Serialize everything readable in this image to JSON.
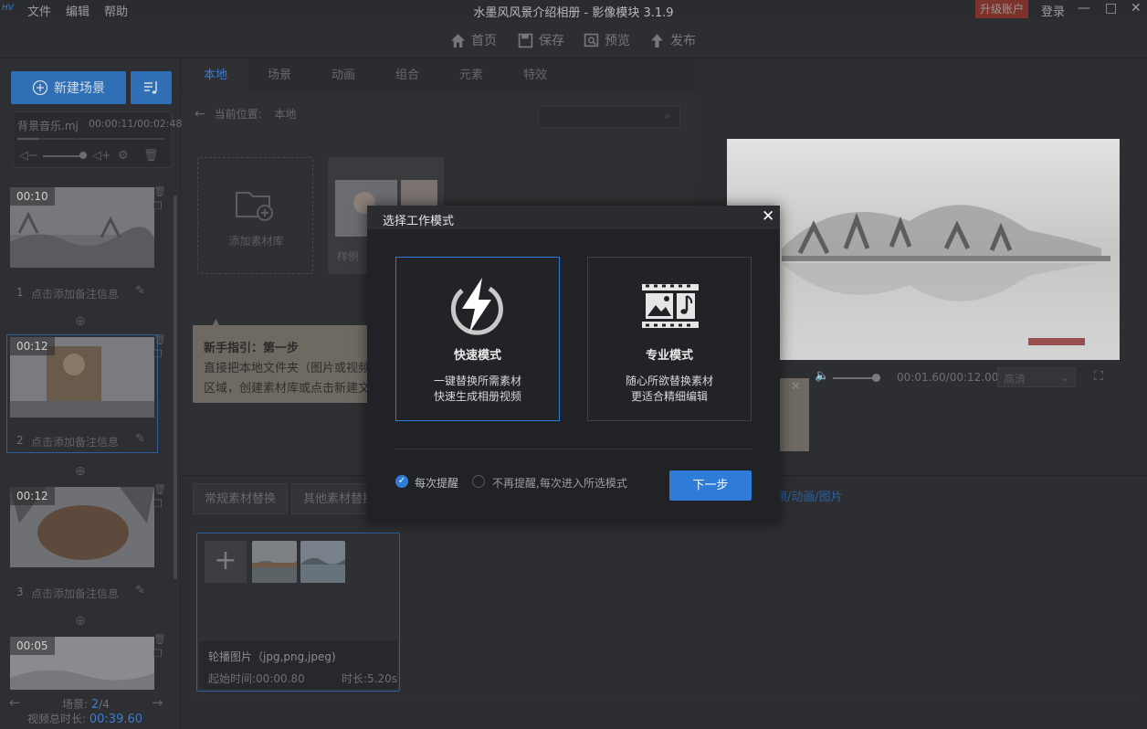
{
  "app": {
    "logo": "HV",
    "title": "水墨风风景介绍相册 - 影像模块 3.1.9",
    "menu": [
      "文件",
      "编辑",
      "帮助"
    ],
    "upgrade": "升级账户",
    "login": "登录",
    "win_buttons": [
      "—",
      "□",
      "✕"
    ]
  },
  "toolbar": {
    "home": "首页",
    "save": "保存",
    "preview": "预览",
    "publish": "发布"
  },
  "left": {
    "new_scene": "新建场景",
    "bgm_name": "背景音乐.mj",
    "bgm_time": "00:00:11/00:02:48",
    "bgm_progress": 0.14,
    "scenes": [
      {
        "dur": "00:10",
        "num": "1",
        "note": "点击添加备注信息"
      },
      {
        "dur": "00:12",
        "num": "2",
        "note": "点击添加备注信息"
      },
      {
        "dur": "00:12",
        "num": "3",
        "note": "点击添加备注信息"
      },
      {
        "dur": "00:05",
        "num": "",
        "note": ""
      }
    ],
    "scene_label": "场景:",
    "scene_cur": "2",
    "scene_total": "/4",
    "total_label": "视频总时长:",
    "total_value": "00:39.60"
  },
  "center": {
    "tabs": [
      "本地",
      "场景",
      "动画",
      "组合",
      "元素",
      "特效"
    ],
    "path_label": "当前位置:",
    "path_value": "本地",
    "add_library": "添加素材库",
    "sample": "样例",
    "guide_title": "新手指引：第一步",
    "guide_line1": "直接把本地文件夹（图片或视频",
    "guide_line2": "区域，创建素材库或点击新建文"
  },
  "preview": {
    "time": "00:01.60/00:12.00",
    "quality": "高清",
    "volume": 0.9
  },
  "bottom": {
    "tabs": [
      "常规素材替换",
      "其他素材替换"
    ],
    "hint": "频/动画/图片",
    "card_title": "轮播图片（jpg,png,jpeg)",
    "card_start": "起始时间:00:00.80",
    "card_duration": "时长:5.20s"
  },
  "modal": {
    "title": "选择工作模式",
    "close": "✕",
    "quick_name": "快速模式",
    "quick_desc1": "一键替换所需素材",
    "quick_desc2": "快速生成相册视频",
    "pro_name": "专业模式",
    "pro_desc1": "随心所欲替换素材",
    "pro_desc2": "更适合精细编辑",
    "remind_each": "每次提醒",
    "remind_never": "不再提醒,每次进入所选模式",
    "next": "下一步"
  },
  "colors": {
    "accent": "#2f7bd8",
    "upgrade": "#c0392b"
  }
}
